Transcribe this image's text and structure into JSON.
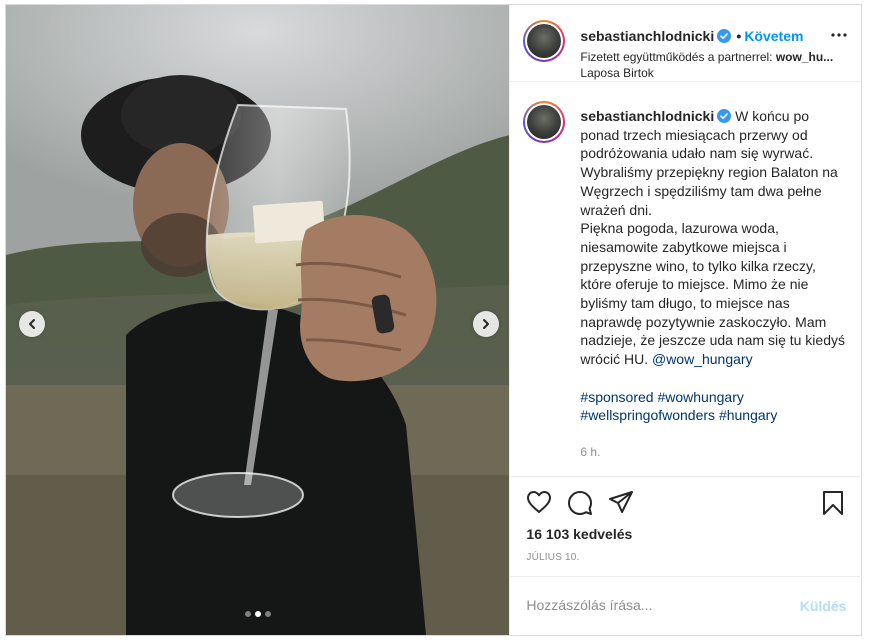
{
  "header": {
    "username": "sebastianchlodnicki",
    "separator": "•",
    "follow_label": "Követem",
    "partner_prefix": "Fizetett együttműködés a partnerrel:",
    "partner_name": "wow_hu...",
    "location": "Laposa Birtok"
  },
  "caption": {
    "username": "sebastianchlodnicki",
    "text": "W końcu po ponad trzech miesiącach przerwy od podróżowania udało nam się wyrwać. Wybraliśmy przepiękny region Balaton na Węgrzech i spędziliśmy tam dwa pełne wrażeń dni.",
    "text2": "Piękna pogoda, lazurowa woda, niesamowite zabytkowe miejsca i przepyszne wino, to tylko kilka rzeczy, które oferuje to miejsce. Mimo że nie byliśmy tam długo, to miejsce nas naprawdę pozytywnie zaskoczyło. Mam nadzieje, że jeszcze uda nam się tu kiedyś wrócić",
    "flag": "HU.",
    "mention": "@wow_hungary",
    "hashtags_line1": [
      "#sponsored",
      "#wowhungary"
    ],
    "hashtags_line2": [
      "#wellspringofwonders",
      "#hungary"
    ],
    "time": "6 h."
  },
  "stats": {
    "likes": "16 103 kedvelés",
    "date": "JÚLIUS 10."
  },
  "comment": {
    "placeholder": "Hozzászólás írása...",
    "post_label": "Küldés"
  },
  "carousel": {
    "slide_count": 3,
    "active_index": 1
  },
  "colors": {
    "accent": "#0095f6",
    "hashtag": "#00376b",
    "muted": "#8e8e8e",
    "disabled_post": "#b2dffc"
  },
  "icons": [
    "chevron-left-icon",
    "chevron-right-icon",
    "verified-badge-icon",
    "more-options-icon",
    "heart-icon",
    "comment-icon",
    "share-icon",
    "bookmark-icon"
  ]
}
